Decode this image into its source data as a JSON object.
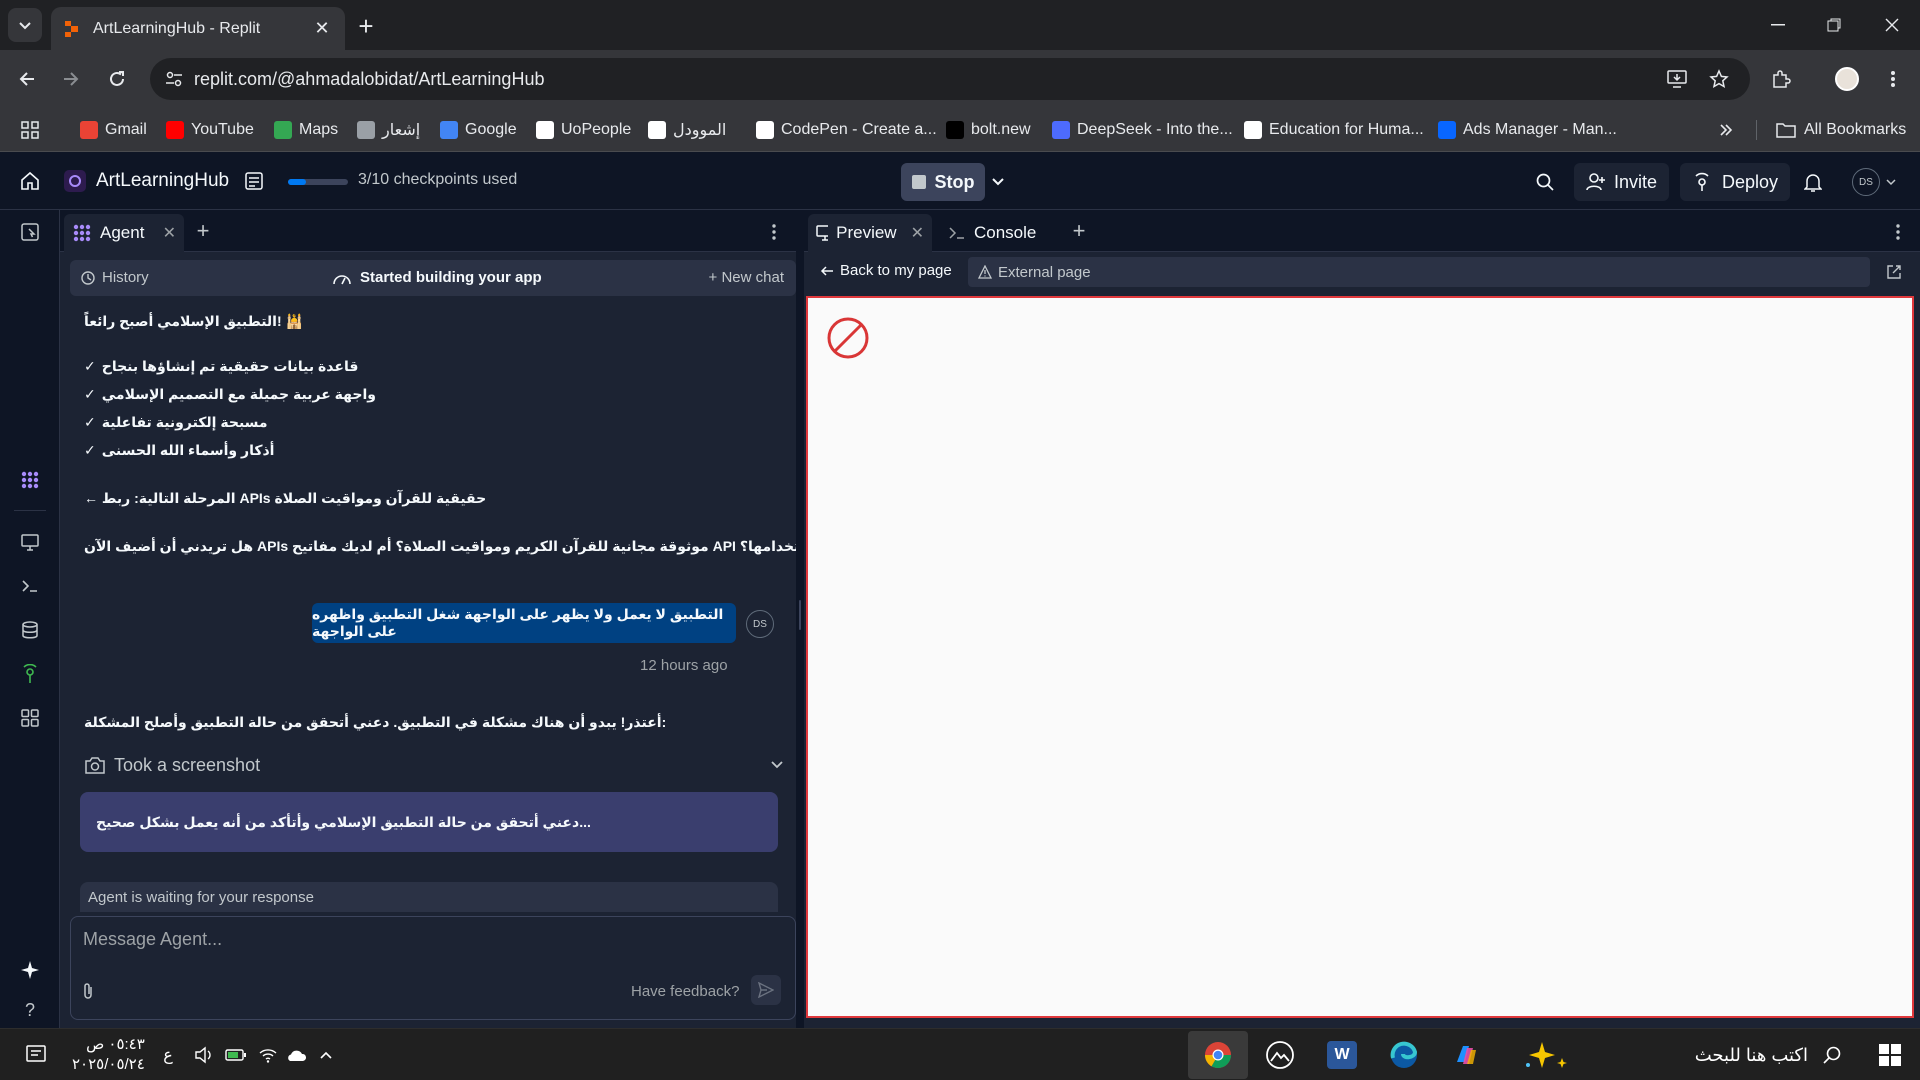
{
  "browser": {
    "tab_title": "ArtLearningHub - Replit",
    "url": "replit.com/@ahmadalobidat/ArtLearningHub",
    "bookmarks": [
      {
        "label": "Gmail",
        "icon": "gmail-icon",
        "color": "#ea4335"
      },
      {
        "label": "YouTube",
        "icon": "youtube-icon",
        "color": "#ff0000"
      },
      {
        "label": "Maps",
        "icon": "maps-icon",
        "color": "#34a853"
      },
      {
        "label": "إشعار",
        "icon": "app-icon",
        "color": "#9aa0a6"
      },
      {
        "label": "Google",
        "icon": "google-icon",
        "color": "#4285f4"
      },
      {
        "label": "UoPeople",
        "icon": "uopeople-icon",
        "color": "#ffffff"
      },
      {
        "label": "الموودل",
        "icon": "moodle-icon",
        "color": "#ffffff"
      },
      {
        "label": "CodePen - Create a...",
        "icon": "codepen-icon",
        "color": "#ffffff"
      },
      {
        "label": "bolt.new",
        "icon": "bolt-icon",
        "color": "#000000"
      },
      {
        "label": "DeepSeek - Into the...",
        "icon": "deepseek-icon",
        "color": "#4d6bfe"
      },
      {
        "label": "Education for Huma...",
        "icon": "globe-icon",
        "color": "#ffffff"
      },
      {
        "label": "Ads Manager - Man...",
        "icon": "meta-icon",
        "color": "#0866ff"
      }
    ],
    "all_bookmarks_label": "All Bookmarks"
  },
  "header": {
    "project_name": "ArtLearningHub",
    "checkpoints_text": "3/10 checkpoints used",
    "checkpoints_progress": 0.3,
    "stop_label": "Stop",
    "invite_label": "Invite",
    "deploy_label": "Deploy",
    "user_initials": "DS"
  },
  "agent": {
    "tab_label": "Agent",
    "history_label": "History",
    "status_label": "Started building your app",
    "new_chat_label": "New chat",
    "messages": {
      "line1": "التطبيق الإسلامي أصبح رائعاً! 🕌",
      "check1": "قاعدة بيانات حقيقية تم إنشاؤها بنجاح",
      "check2": "واجهة عربية جميلة مع التصميم الإسلامي",
      "check3": "مسبحة إلكترونية تفاعلية",
      "check4": "أذكار وأسماء الله الحسنى",
      "next_step": "← المرحلة التالية: ربط APIs حقيقية للقرآن ومواقيت الصلاة",
      "question": "هل تريدني أن أضيف الآن APIs موثوقة مجانية للقرآن الكريم ومواقيت الصلاة؟ أم لديك مفاتيح API خاصة تريد استخدامها؟",
      "user_message": "التطبيق لا يعمل ولا يظهر  على الواجهة شغل التطبيق واظهره على الواجهة",
      "user_initials": "DS",
      "timestamp": "12 hours ago",
      "reply": "أعتذر! يبدو أن هناك مشكلة في التطبيق. دعني أتحقق من حالة التطبيق وأصلح المشكلة:",
      "screenshot_label": "Took a screenshot",
      "thinking": "دعني أتحقق من حالة التطبيق الإسلامي وأتأكد من أنه يعمل بشكل صحيح..."
    },
    "waiting_label": "Agent is waiting for your response",
    "input_placeholder": "Message Agent...",
    "feedback_label": "Have feedback?"
  },
  "preview": {
    "tab_preview": "Preview",
    "tab_console": "Console",
    "back_label": "Back to my page",
    "url_label": "External page",
    "frame_border_color": "#e0383c"
  },
  "taskbar": {
    "time": "٠٥:٤٣ ص",
    "date": "٢٠٢٥/٠٥/٢٤",
    "lang": "ع",
    "search_placeholder": "اكتب هنا للبحث"
  }
}
